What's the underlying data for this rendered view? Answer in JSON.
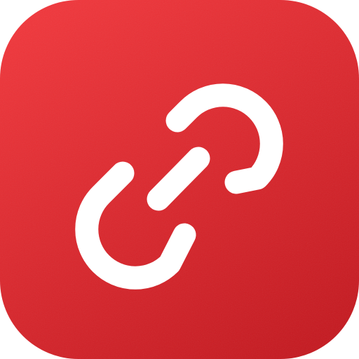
{
  "icon": {
    "name": "link-icon",
    "background_color_top": "#f0353a",
    "background_color_bottom": "#c5181f",
    "glyph_color": "#ffffff"
  }
}
